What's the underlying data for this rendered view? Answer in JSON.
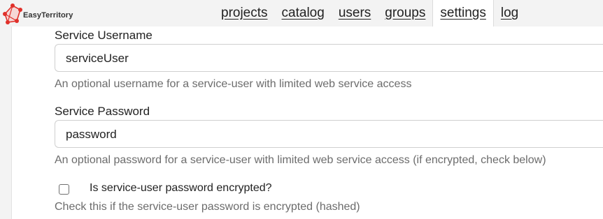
{
  "app": {
    "logo_text": "EasyTerritory"
  },
  "nav": {
    "items": [
      {
        "label": "projects"
      },
      {
        "label": "catalog"
      },
      {
        "label": "users"
      },
      {
        "label": "groups"
      },
      {
        "label": "settings",
        "active": true
      },
      {
        "label": "log"
      }
    ]
  },
  "form": {
    "service_username": {
      "label": "Service Username",
      "value": "serviceUser",
      "help": "An optional username for a service-user with limited web service access"
    },
    "service_password": {
      "label": "Service Password",
      "value": "password",
      "help": "An optional password for a service-user with limited web service access (if encrypted, check below)"
    },
    "encrypted": {
      "label": "Is service-user password encrypted?",
      "checked": false,
      "help": "Check this if the service-user password is encrypted (hashed)"
    }
  },
  "colors": {
    "logo_accent": "#e0302a",
    "page_bg": "#f3f3f3",
    "help_text": "#6c6c6c"
  },
  "icons": {
    "logo": "easyterritory-logo-icon",
    "checkbox": "checkbox-unchecked"
  }
}
